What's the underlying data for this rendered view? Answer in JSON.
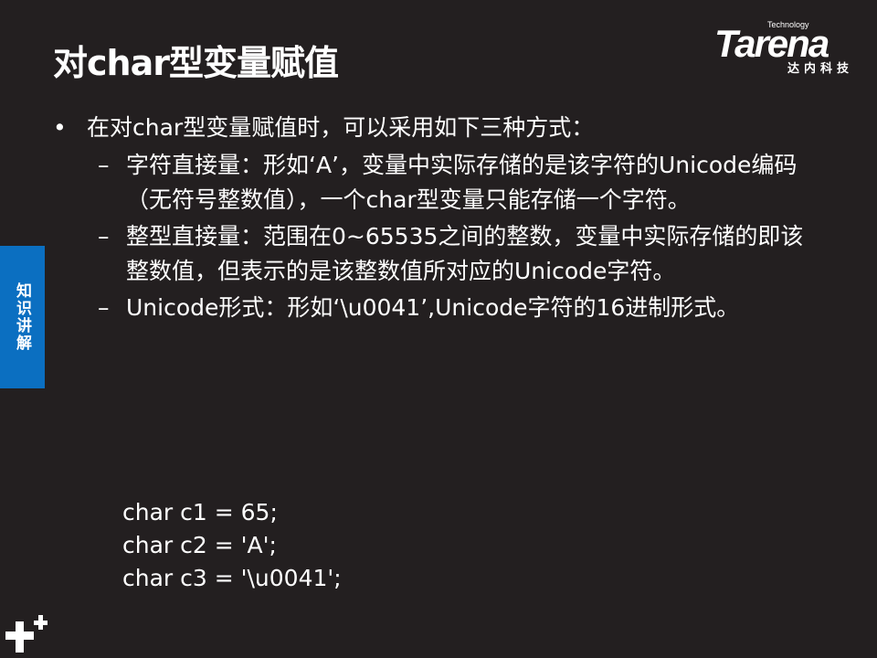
{
  "title": "对char型变量赋值",
  "logo": {
    "brand": "Tarena",
    "tagline": "Technology",
    "cn": "达内科技"
  },
  "side_tab": "知识讲解",
  "bullet": "在对char型变量赋值时，可以采用如下三种方式：",
  "sub_items": [
    "字符直接量：形如‘A’，变量中实际存储的是该字符的Unicode编码（无符号整数值），一个char型变量只能存储一个字符。",
    "整型直接量：范围在0~65535之间的整数，变量中实际存储的即该整数值，但表示的是该整数值所对应的Unicode字符。",
    "Unicode形式：形如‘\\u0041’,Unicode字符的16进制形式。"
  ],
  "code": [
    "char c1 = 65;",
    "char c2 = 'A';",
    "char c3 = '\\u0041';"
  ],
  "colors": {
    "background": "#231f20",
    "tab": "#0b6fc1"
  },
  "icons": [
    "plus-plus-icon"
  ]
}
